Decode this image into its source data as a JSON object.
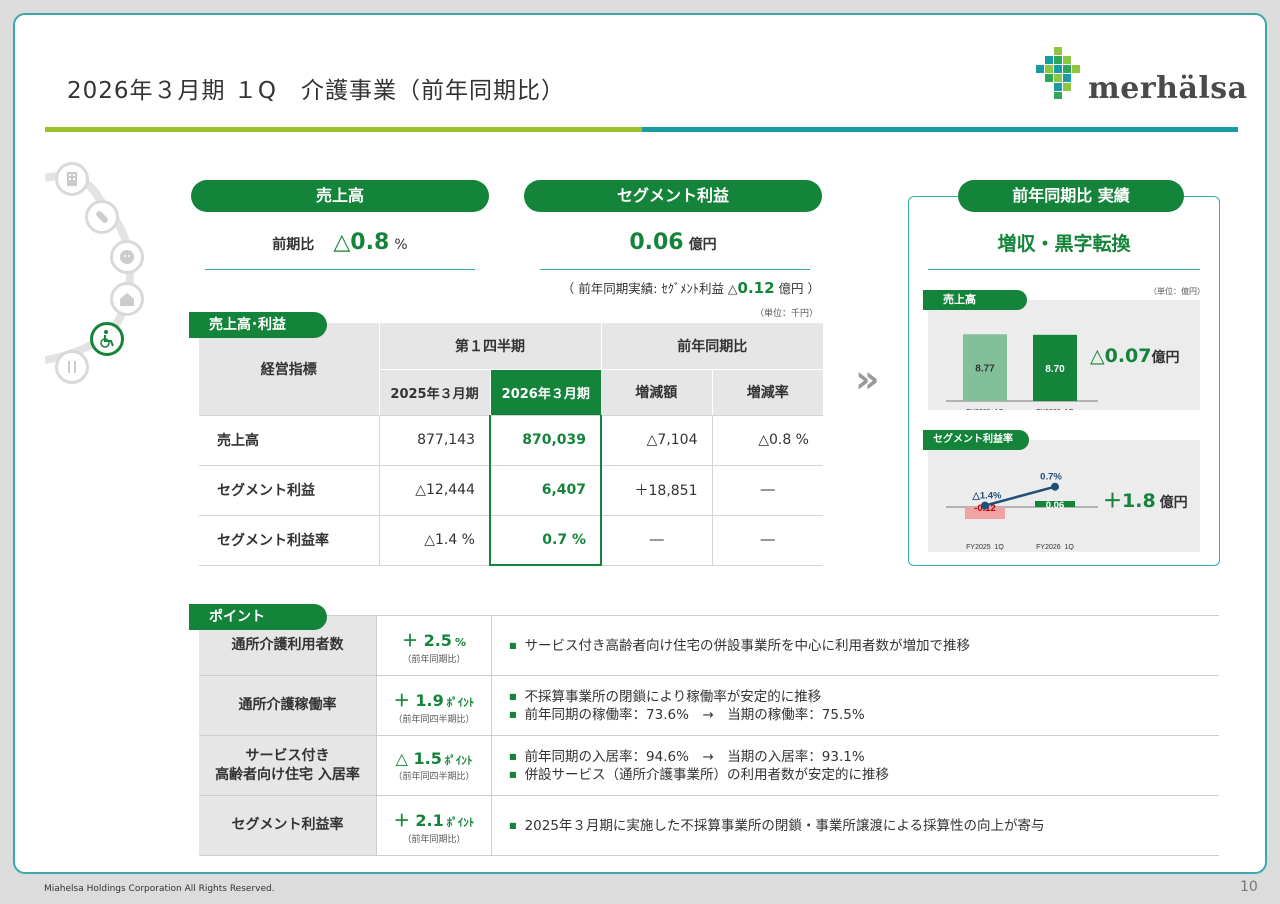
{
  "page": {
    "title": "2026年３月期 １Q　介護事業（前年同期比）",
    "footer": "Miahelsa Holdings Corporation All Rights Reserved.",
    "page_number": "10"
  },
  "logo": {
    "text": "merhälsa"
  },
  "sales": {
    "header": "売上高",
    "prefix": "前期比",
    "value": "△0.8",
    "unit": "%"
  },
  "segment": {
    "header": "セグメント利益",
    "value": "0.06",
    "unit": "億円",
    "note_pre": "（ 前年同期実績: ｾｸﾞﾒﾝﾄ利益 △",
    "note_val": "0.12",
    "note_post": " 億円 ）"
  },
  "table": {
    "tag": "売上高･利益",
    "unit_note": "（単位：千円）",
    "col_indicator": "経営指標",
    "col_q1": "第１四半期",
    "col_yoy": "前年同期比",
    "col_2025": "2025年３月期",
    "col_2026": "2026年３月期",
    "col_diff": "増減額",
    "col_rate": "増減率",
    "rows": [
      {
        "label": "売上高",
        "prev": "877,143",
        "curr": "870,039",
        "diff": "△7,104",
        "rate": "△0.8 %"
      },
      {
        "label": "セグメント利益",
        "prev": "△12,444",
        "curr": "6,407",
        "diff": "＋18,851",
        "rate": "―"
      },
      {
        "label": "セグメント利益率",
        "prev": "△1.4 %",
        "curr": "0.7 %",
        "diff": "―",
        "rate": "―"
      }
    ]
  },
  "arrow": "»",
  "results": {
    "header": "前年同期比 実績",
    "summary": "増収・黒字転換",
    "unit_note": "（単位：億円）",
    "sales_tag": "売上高",
    "sales_delta": "△0.07",
    "sales_delta_unit": "億円",
    "margin_tag": "セグメント利益率",
    "margin_delta": "＋1.8",
    "margin_delta_unit": "億円"
  },
  "chart_data": [
    {
      "type": "bar",
      "title": "売上高",
      "categories": [
        "FY2025_1Q",
        "FY2026_1Q"
      ],
      "values": [
        8.77,
        8.7
      ],
      "colors": [
        "#82c09a",
        "#15843b"
      ]
    },
    {
      "type": "bar",
      "title": "セグメント利益率",
      "categories": [
        "FY2025_1Q",
        "FY2026_1Q"
      ],
      "values": [
        -0.12,
        0.06
      ],
      "colors": [
        "#f0a3a3",
        "#15843b"
      ],
      "line_series": {
        "values": [
          -1.4,
          0.7
        ],
        "labels": [
          "△1.4%",
          "0.7%"
        ],
        "color": "#1f4e79"
      }
    }
  ],
  "points": {
    "tag": "ポイント",
    "rows": [
      {
        "label": "通所介護利用者数",
        "value": "＋ 2.5",
        "unit": "%",
        "sub": "（前年同期比）",
        "texts": [
          "サービス付き高齢者向け住宅の併設事業所を中心に利用者数が増加で推移"
        ]
      },
      {
        "label": "通所介護稼働率",
        "value": "＋ 1.9",
        "unit": "ﾎﾟｲﾝﾄ",
        "sub": "（前年同四半期比）",
        "texts": [
          "不採算事業所の閉鎖により稼働率が安定的に推移",
          "前年同期の稼働率：73.6%　→　当期の稼働率：75.5%"
        ]
      },
      {
        "label": "サービス付き\n高齢者向け住宅 入居率",
        "value": "△ 1.5",
        "unit": "ﾎﾟｲﾝﾄ",
        "sub": "（前年同四半期比）",
        "texts": [
          "前年同期の入居率：94.6%　→　当期の入居率：93.1%",
          "併設サービス（通所介護事業所）の利用者数が安定的に推移"
        ]
      },
      {
        "label": "セグメント利益率",
        "value": "＋ 2.1",
        "unit": "ﾎﾟｲﾝﾄ",
        "sub": "（前年同期比）",
        "texts": [
          "2025年３月期に実施した不採算事業所の閉鎖・事業所譲渡による採算性の向上が寄与"
        ]
      }
    ]
  },
  "side_icons": [
    "building-icon",
    "pill-icon",
    "child-icon",
    "house-icon",
    "wheelchair-icon",
    "meal-icon"
  ]
}
